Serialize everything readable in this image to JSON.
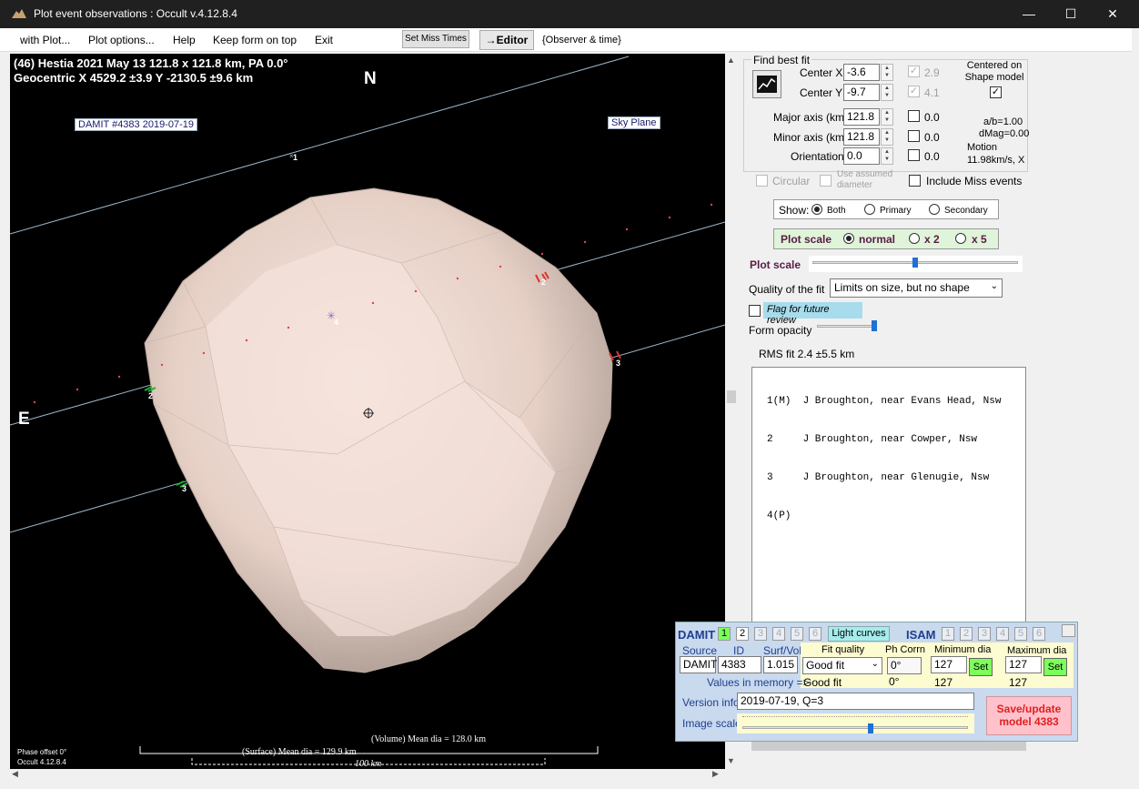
{
  "window": {
    "title": "Plot event observations : Occult v.4.12.8.4",
    "minimize": "—",
    "maximize": "☐",
    "close": "✕"
  },
  "menu": {
    "with_plot": "with Plot...",
    "plot_options": "Plot options...",
    "help": "Help",
    "keep_on_top": "Keep form on top",
    "exit": "Exit",
    "set_miss_times": "Set Miss Times",
    "editor": "→Editor",
    "observer_time": "{Observer & time}"
  },
  "plot": {
    "header_line1": "(46) Hestia  2021 May 13   121.8 x 121.8 km,  PA 0.0°",
    "header_line2": "Geocentric  X  4529.2 ±3.9  Y -2130.5 ±9.6 km",
    "north": "N",
    "east": "E",
    "damit_label": "DAMIT #4383 2019-07-19",
    "sky_plane": "Sky Plane",
    "chord_labels": [
      "1",
      "2",
      "2",
      "3",
      "3",
      "4"
    ],
    "volume_text": "(Volume) Mean dia = 128.0 km",
    "surface_text": "(Surface) Mean dia = 129.9 km",
    "scale_text": "100 km",
    "phase_offset": "Phase offset 0°",
    "occult_version": "Occult 4.12.8.4"
  },
  "fit": {
    "find_best_fit": "Find best fit",
    "center_x_label": "Center X",
    "center_x": "-3.6",
    "center_x_unc": "2.9",
    "center_y_label": "Center Y",
    "center_y": "-9.7",
    "center_y_unc": "4.1",
    "centered_on_shape": "Centered on Shape model",
    "major_label": "Major axis (km)",
    "major": "121.8",
    "major_unc": "0.0",
    "minor_label": "Minor axis (km)",
    "minor": "121.8",
    "minor_unc": "0.0",
    "orient_label": "Orientation",
    "orient": "0.0",
    "orient_unc": "0.0",
    "ab": "a/b=1.00",
    "dmag": "dMag=0.00",
    "motion_label": "Motion",
    "motion": "11.98km/s, X",
    "circular": "Circular",
    "use_assumed": "Use assumed diameter",
    "include_miss": "Include Miss events"
  },
  "show": {
    "label": "Show:",
    "both": "Both",
    "primary": "Primary",
    "secondary": "Secondary"
  },
  "plotscale": {
    "label": "Plot scale",
    "normal": "normal",
    "x2": "x 2",
    "x5": "x 5",
    "slider_label": "Plot scale",
    "slider_value": 0.5
  },
  "quality": {
    "label": "Quality of the fit",
    "value": "Limits on size, but no shape"
  },
  "flag": {
    "label": "Flag for future review"
  },
  "opacity": {
    "label": "Form opacity",
    "value": 1.0
  },
  "rms": "RMS fit 2.4 ±5.5 km",
  "observers": [
    "1(M)  J Broughton, near Evans Head, Nsw",
    "2     J Broughton, near Cowper, Nsw",
    "3     J Broughton, near Glenugie, Nsw",
    "4(P)"
  ],
  "damit": {
    "title": "DAMIT",
    "nums": [
      "1",
      "2",
      "3",
      "4",
      "5",
      "6"
    ],
    "light_curves": "Light curves",
    "isam": "ISAM",
    "source_label": "Source",
    "id_label": "ID",
    "surfvol_label": "Surf/Vol",
    "source": "DAMIT",
    "id": "4383",
    "surfvol": "1.015",
    "fitq_label": "Fit quality",
    "phcorr_label": "Ph Corrn",
    "mindia_label": "Minimum dia",
    "maxdia_label": "Maximum dia",
    "fitq": "Good fit",
    "phcorr": "0°",
    "mindia": "127",
    "maxdia": "127",
    "set": "Set",
    "memory_label": "Values in memory =>",
    "mem_fitq": "Good fit",
    "mem_ph": "0°",
    "mem_min": "127",
    "mem_max": "127",
    "version_label": "Version info",
    "version": "2019-07-19, Q=3",
    "image_scale": "Image scale",
    "image_scale_value": 0.57,
    "save": "Save/update model 4383"
  }
}
